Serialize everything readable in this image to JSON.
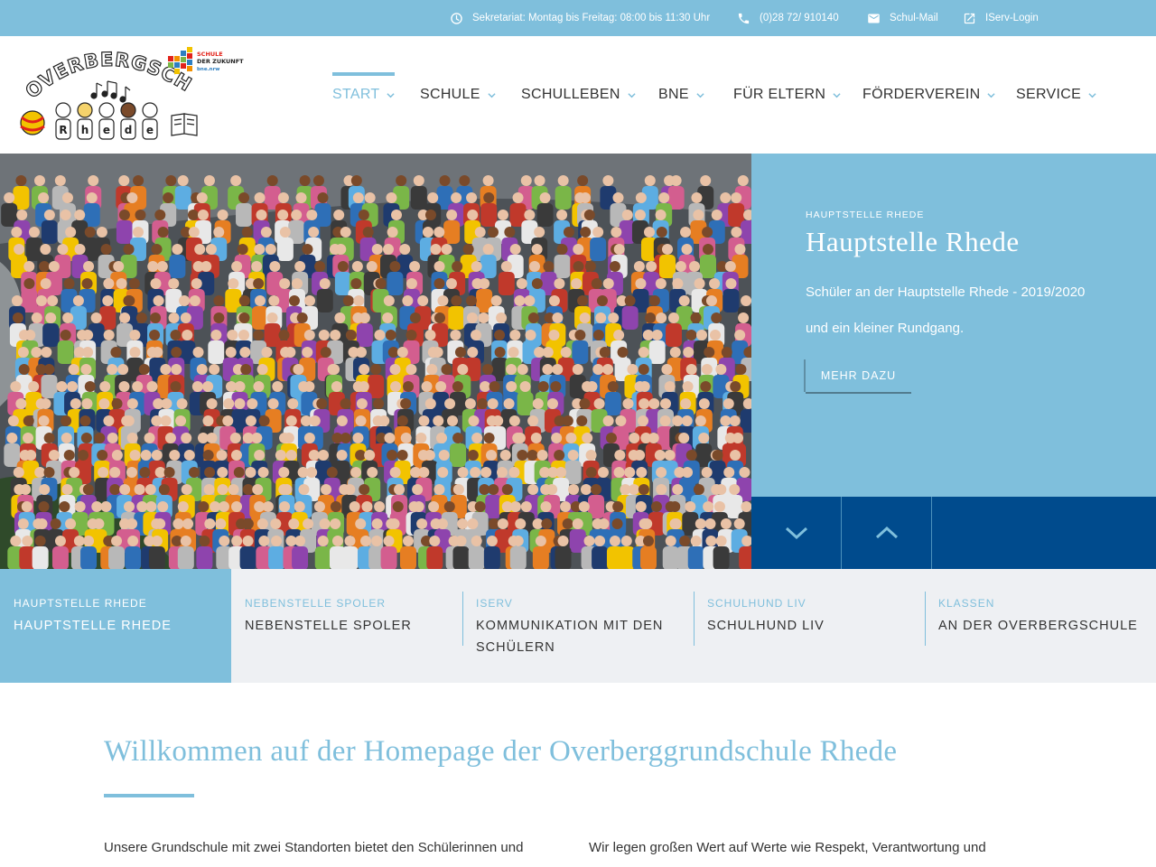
{
  "topbar": {
    "hours": "Sekretariat: Montag bis Freitag: 08:00 bis 11:30 Uhr",
    "phone": "(0)28 72/ 910140",
    "mail": "Schul-Mail",
    "iserv": "IServ-Login",
    "icons": [
      "clock-icon",
      "phone-icon",
      "mail-icon",
      "external-link-icon"
    ]
  },
  "logo": {
    "name": "OVERBERGSCHULE",
    "town_letters": [
      "R",
      "h",
      "e",
      "d",
      "e"
    ],
    "badge_line1": "SCHULE",
    "badge_line2": "DER ZUKUNFT",
    "badge_line3": "bne.nrw"
  },
  "nav": [
    {
      "label": "START",
      "active": true
    },
    {
      "label": "SCHULE",
      "active": false
    },
    {
      "label": "SCHULLEBEN",
      "active": false
    },
    {
      "label": "BNE",
      "active": false
    },
    {
      "label": "FÜR ELTERN",
      "active": false
    },
    {
      "label": "FÖRDERVEREIN",
      "active": false
    },
    {
      "label": "SERVICE",
      "active": false
    }
  ],
  "hero": {
    "eyebrow": "HAUPTSTELLE RHEDE",
    "title": "Hauptstelle Rhede",
    "line1": "Schüler an der Hauptstelle Rhede - 2019/2020",
    "line2": "und ein kleiner Rundgang.",
    "button": "MEHR DAZU"
  },
  "tabs": [
    {
      "eyebrow": "HAUPTSTELLE RHEDE",
      "label": "HAUPTSTELLE RHEDE",
      "active": true
    },
    {
      "eyebrow": "NEBENSTELLE SPOLER",
      "label": "NEBENSTELLE SPOLER",
      "active": false
    },
    {
      "eyebrow": "ISERV",
      "label": "KOMMUNIKATION MIT DEN SCHÜLERN",
      "active": false
    },
    {
      "eyebrow": "SCHULHUND LIV",
      "label": "SCHULHUND LIV",
      "active": false
    },
    {
      "eyebrow": "KLASSEN",
      "label": "AN DER OVERBERGSCHULE",
      "active": false
    }
  ],
  "welcome": {
    "title": "Willkommen auf der Homepage der Overberggrundschule Rhede",
    "para_left": "Unsere Grundschule mit zwei Standorten bietet den Schülerinnen und",
    "para_right": "Wir legen großen Wert auf Werte wie Respekt, Verantwortung und"
  },
  "colors": {
    "accent": "#7fbfdc",
    "dark_blue": "#004b8d",
    "tab_bg": "#eef0f3",
    "text": "#333333"
  }
}
